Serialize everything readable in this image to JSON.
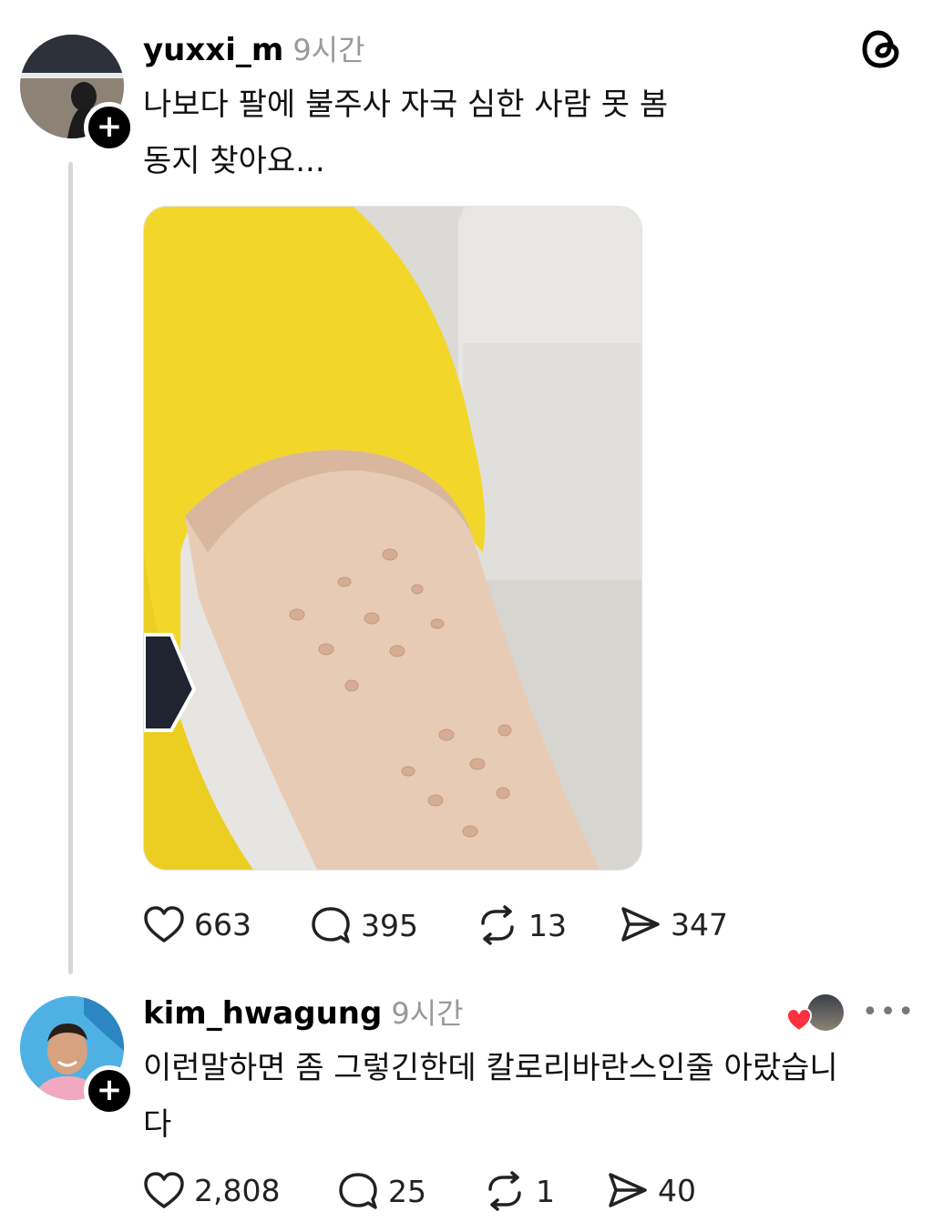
{
  "post": {
    "username": "yuxxi_m",
    "time": "9시간",
    "text_line1": "나보다 팔에 불주사 자국 심한 사람 못 봄",
    "text_line2": "동지 찾아요...",
    "actions": {
      "likes": "663",
      "comments": "395",
      "reposts": "13",
      "shares": "347"
    }
  },
  "reply": {
    "username": "kim_hwagung",
    "time": "9시간",
    "text_line1": "이런말하면 좀 그렇긴한데 칼로리바란스인줄 아랐습니",
    "text_line2": "다",
    "actions": {
      "likes": "2,808",
      "comments": "25",
      "reposts": "1",
      "shares": "40"
    }
  },
  "icons": {
    "app_logo": "threads-logo-icon",
    "follow": "plus-icon",
    "like": "heart-icon",
    "comment": "comment-bubble-icon",
    "repost": "repost-icon",
    "share": "send-icon",
    "more": "more-dots-icon",
    "author_liked": "red-heart-icon"
  },
  "more_glyph": "•••",
  "colors": {
    "accent_red": "#ff3040",
    "muted": "#9a9a9a",
    "shirt_yellow": "#f2d72a"
  }
}
